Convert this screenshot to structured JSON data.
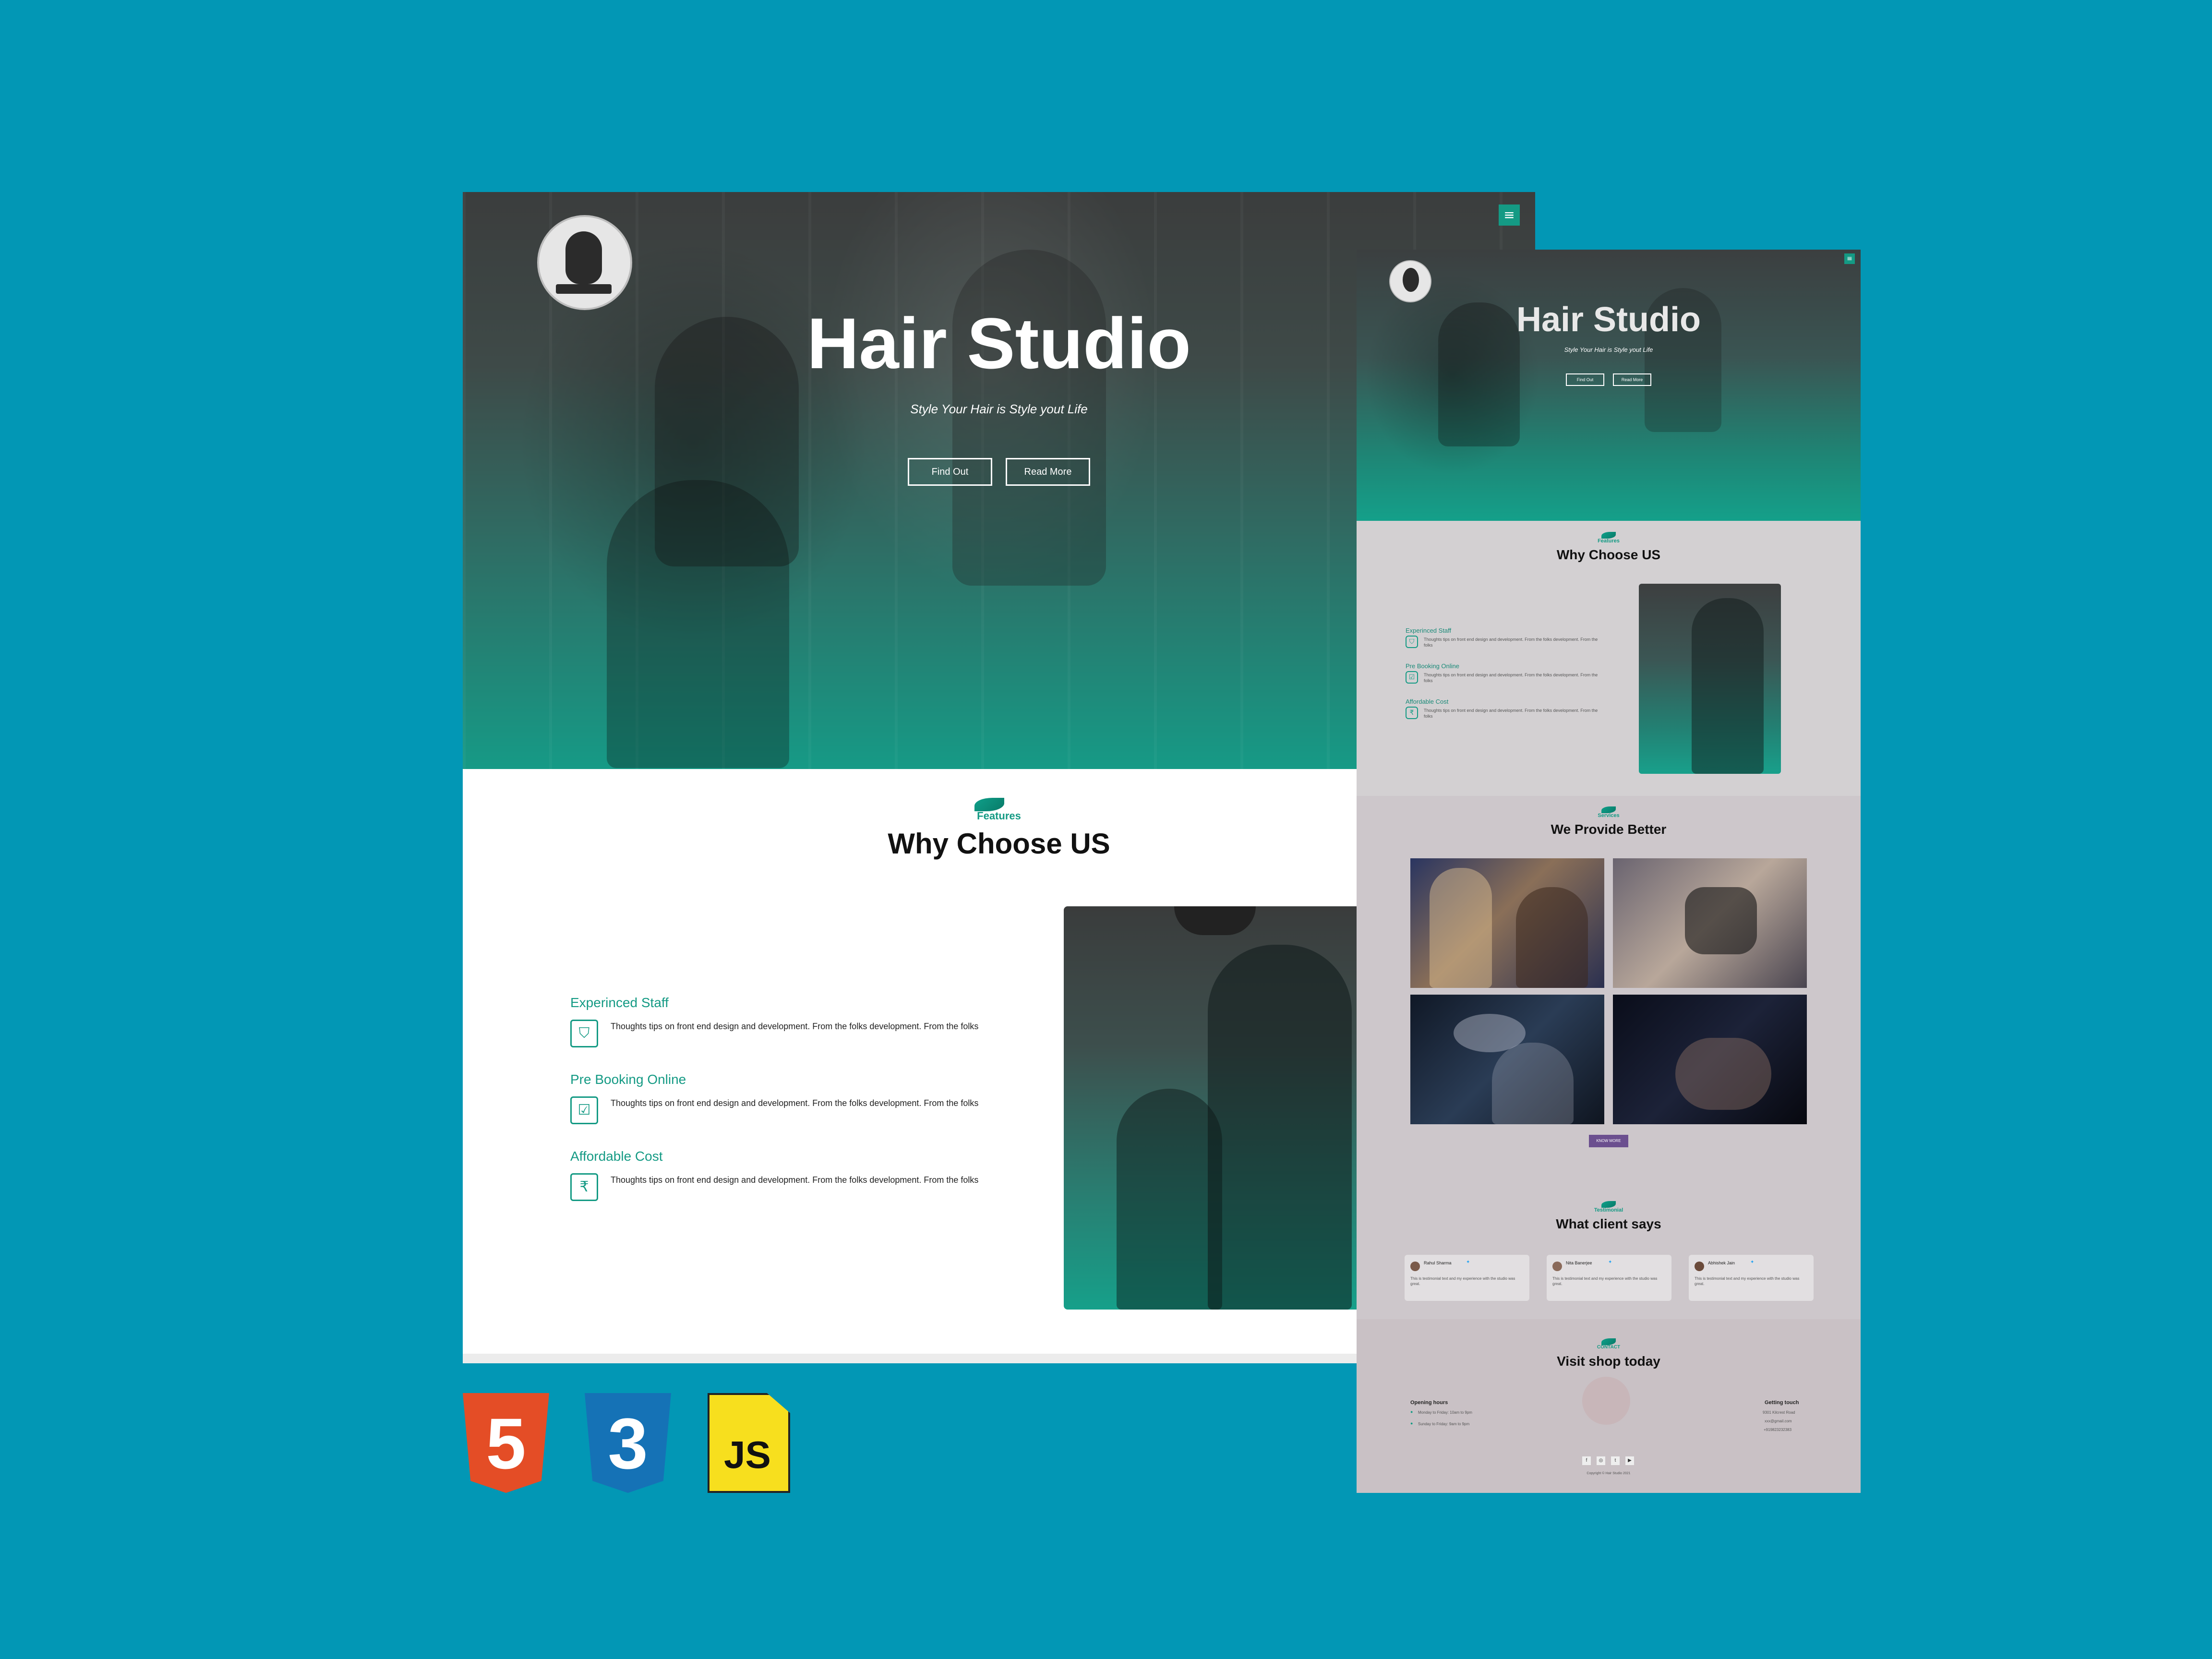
{
  "hero": {
    "title": "Hair Studio",
    "subtitle": "Style Your Hair is Style yout Life",
    "buttons": [
      "Find Out",
      "Read More"
    ],
    "menu_icon": "hamburger-icon"
  },
  "features": {
    "kicker": "Features",
    "title": "Why Choose US",
    "items": [
      {
        "title": "Experinced Staff",
        "text": "Thoughts tips on front end design and development. From the folks development. From the folks",
        "icon": "shield-icon"
      },
      {
        "title": "Pre Booking Online",
        "text": "Thoughts tips on front end design and development. From the folks development. From the folks",
        "icon": "checkbox-icon"
      },
      {
        "title": "Affordable Cost",
        "text": "Thoughts tips on front end design and development. From the folks development. From the folks",
        "icon": "rupee-icon"
      }
    ]
  },
  "services": {
    "kicker": "Services",
    "title": "We Provide Better",
    "button": "KNOW MORE"
  },
  "testimonials": {
    "kicker": "Testimonial",
    "title": "What client says",
    "cards": [
      {
        "name": "Rahul Sharma",
        "text": "This is testimonial text and my experience with the studio was great."
      },
      {
        "name": "Nita Banerjee",
        "text": "This is testimonial text and my experience with the studio was great."
      },
      {
        "name": "Abhishek Jain",
        "text": "This is testimonial text and my experience with the studio was great."
      }
    ]
  },
  "contact": {
    "kicker": "CONTACT",
    "title": "Visit shop today",
    "hours_title": "Opening hours",
    "hours": [
      "Monday to Friday: 10am to 9pm",
      "Sunday to Friday: 9am to 9pm"
    ],
    "touch_title": "Getting touch",
    "touch": [
      "9301 Kilcrest Road",
      "xxx@gmail.com",
      "+919823232383"
    ],
    "social_icons": [
      "facebook-icon",
      "instagram-icon",
      "twitter-icon",
      "youtube-icon"
    ],
    "copyright": "Copyright © Hair Studio 2021"
  },
  "badges": {
    "html": "5",
    "css": "3",
    "js": "JS"
  },
  "colors": {
    "background": "#0297b5",
    "accent": "#149a84",
    "button_purple": "#6b4f8f"
  }
}
